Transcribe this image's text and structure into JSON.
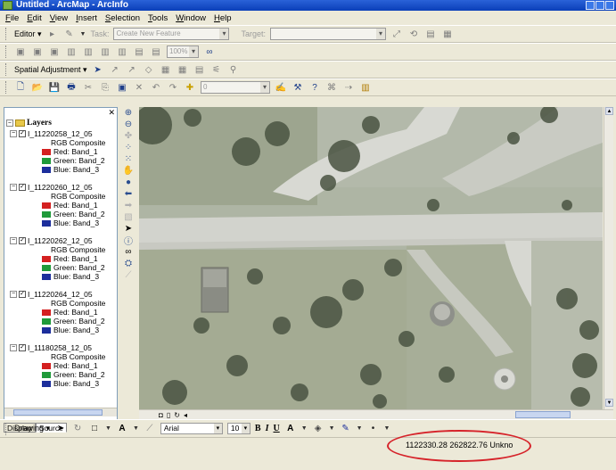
{
  "window": {
    "title": "Untitled - ArcMap - ArcInfo"
  },
  "menu": [
    "File",
    "Edit",
    "View",
    "Insert",
    "Selection",
    "Tools",
    "Window",
    "Help"
  ],
  "editor_toolbar": {
    "editor_label": "Editor ▾",
    "task_label": "Task:",
    "task_value": "Create New Feature",
    "target_label": "Target:",
    "target_value": ""
  },
  "georef_toolbar": {
    "zoom_value": "100%"
  },
  "spatial_adjustment": {
    "label": "Spatial Adjustment ▾"
  },
  "standard_toolbar": {
    "scale_value": "0"
  },
  "toc": {
    "root_label": "Layers",
    "composite_label": "RGB Composite",
    "layers": [
      {
        "name": "I_11220258_12_05",
        "bands": [
          "Red:  Band_1",
          "Green: Band_2",
          "Blue:  Band_3"
        ]
      },
      {
        "name": "I_11220260_12_05",
        "bands": [
          "Red:  Band_1",
          "Green: Band_2",
          "Blue:  Band_3"
        ]
      },
      {
        "name": "I_11220262_12_05",
        "bands": [
          "Red:  Band_1",
          "Green: Band_2",
          "Blue:  Band_3"
        ]
      },
      {
        "name": "I_11220264_12_05",
        "bands": [
          "Red:  Band_1",
          "Green: Band_2",
          "Blue:  Band_3"
        ]
      },
      {
        "name": "I_11180258_12_05",
        "bands": [
          "Red:  Band_1",
          "Green: Band_2",
          "Blue:  Band_3"
        ]
      }
    ],
    "band_colors": [
      "#d42020",
      "#1f9a3a",
      "#1c2e9c"
    ],
    "tabs": [
      "Display",
      "Source"
    ],
    "active_tab": "Source"
  },
  "draw_toolbar": {
    "drawing_label": "Drawing ▾",
    "font_name": "Arial",
    "font_size": "10",
    "bold": "B",
    "italic": "I",
    "underline": "U"
  },
  "status": {
    "coordinates": "1122330.28  262822.76 Unkno"
  },
  "accent": {
    "highlight": "#d6232a",
    "titlebar": "#0a3fb8"
  }
}
